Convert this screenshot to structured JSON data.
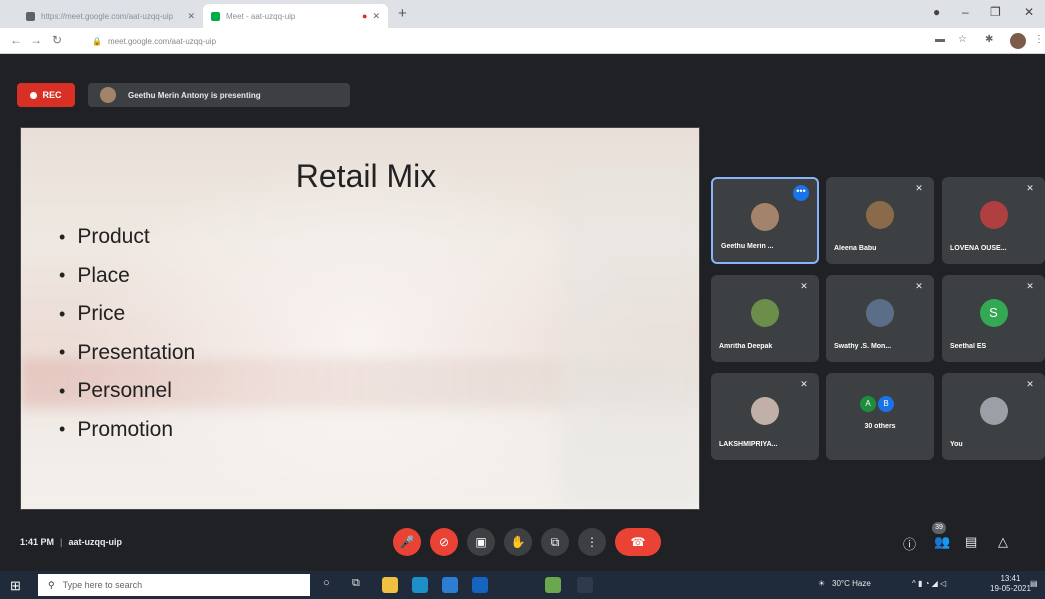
{
  "browser": {
    "tabs": [
      {
        "label": "https://meet.google.com/aat-uzqq-uip"
      },
      {
        "label": "Meet - aat-uzqq-uip"
      }
    ],
    "url": "meet.google.com/aat-uzqq-uip"
  },
  "meet": {
    "rec_label": "REC",
    "presenting_text": "Geethu Merin Antony is presenting",
    "slide": {
      "title": "Retail Mix",
      "bullets": [
        "Product",
        "Place",
        "Price",
        "Presentation",
        "Personnel",
        "Promotion"
      ]
    },
    "participants": [
      {
        "name": "Geethu Merin ...",
        "avatar_color": "#a4836b"
      },
      {
        "name": "Aleena Babu",
        "avatar_color": "#8a6a4a"
      },
      {
        "name": "LOVENA OUSE...",
        "avatar_color": "#b04040"
      },
      {
        "name": "Amritha Deepak",
        "avatar_color": "#6b8f4a"
      },
      {
        "name": "Swathy .S. Mon...",
        "avatar_color": "#5a6e8a"
      },
      {
        "name": "Seethal ES",
        "initial": "S",
        "avatar_color": "#34a853"
      },
      {
        "name": "LAKSHMIPRIYA...",
        "avatar_color": "#c0b0a8"
      },
      {
        "name": "30 others",
        "mini": [
          "A",
          "B"
        ]
      },
      {
        "name": "You",
        "avatar_color": "#9aa0a6"
      }
    ],
    "time": "1:41 PM",
    "meeting_code": "aat-uzqq-uip",
    "participant_count": "39"
  },
  "taskbar": {
    "search_placeholder": "Type here to search",
    "weather": "30°C Haze",
    "clock_time": "13:41",
    "clock_date": "19-05-2021"
  },
  "colors": {
    "meet_bg": "#202124",
    "tile_bg": "#3c4043",
    "red": "#ea4335",
    "accent": "#8ab4f8"
  }
}
